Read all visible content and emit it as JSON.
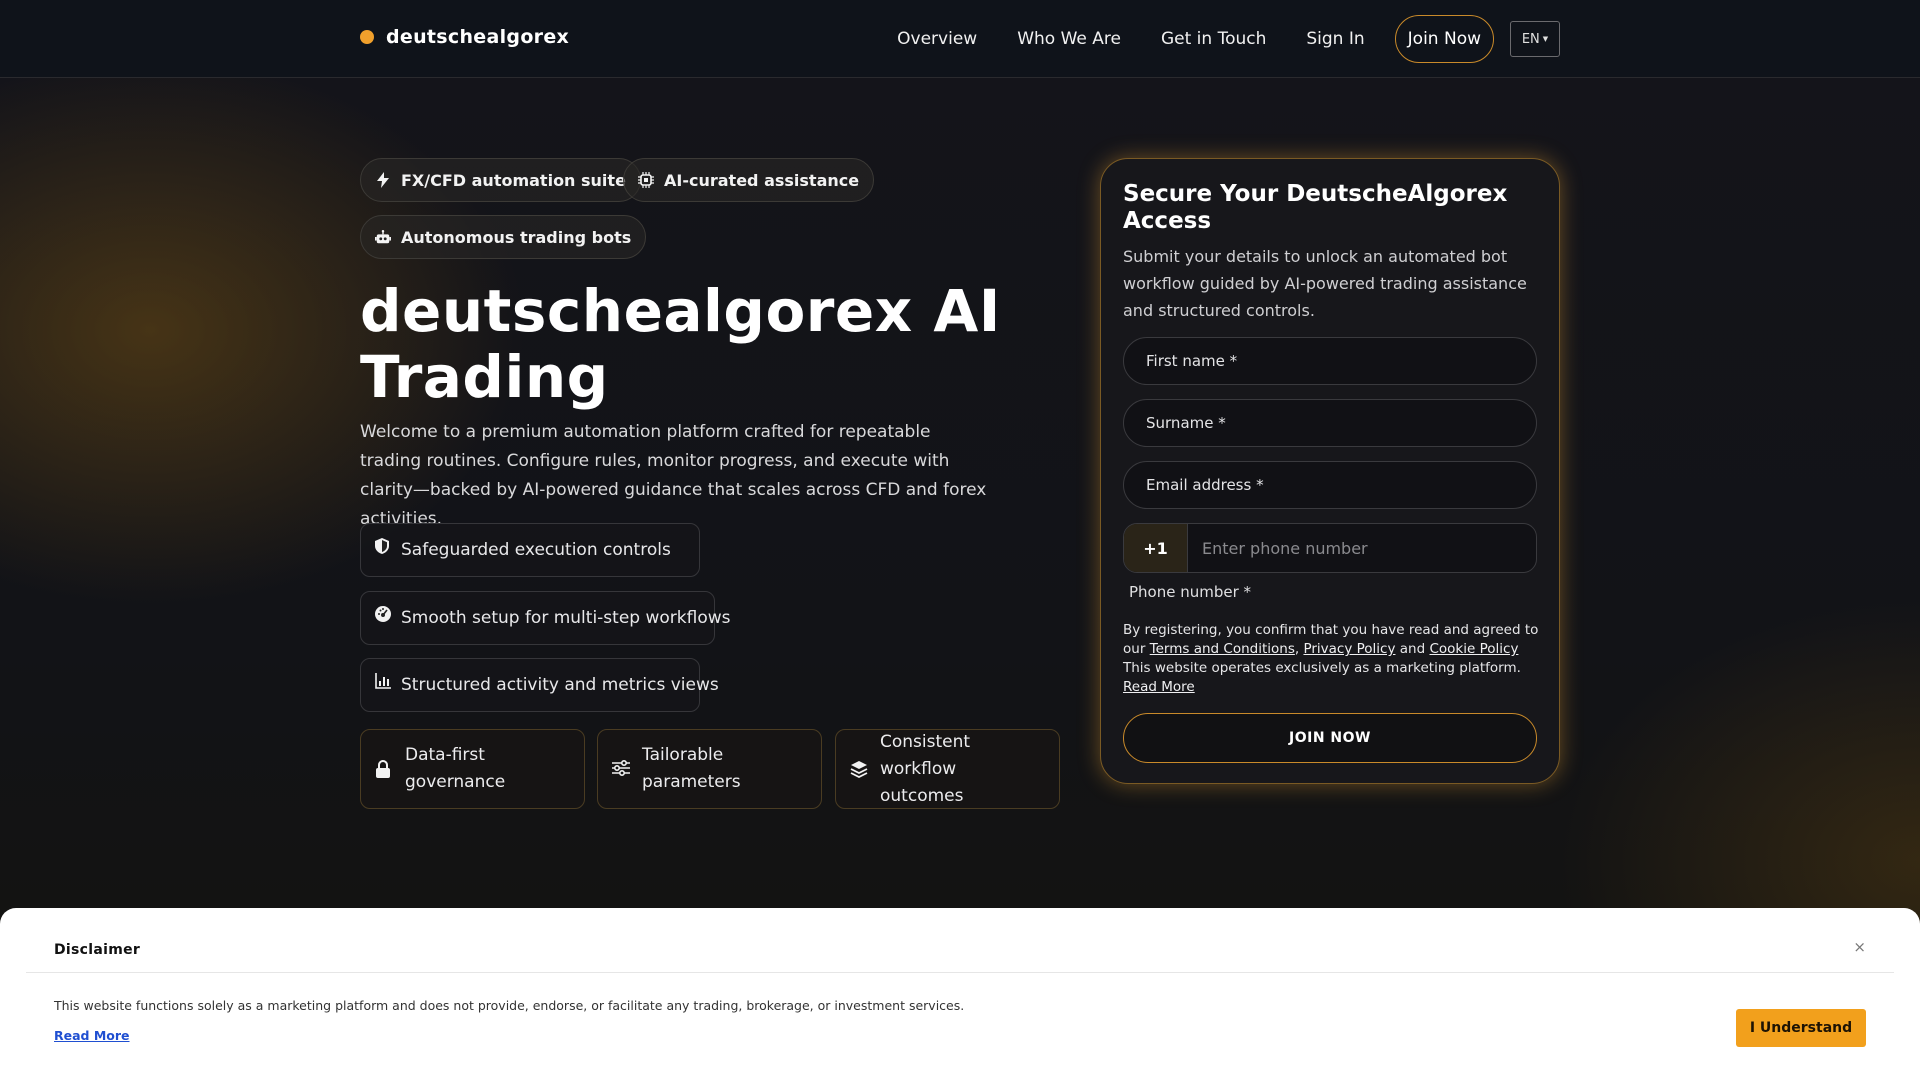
{
  "header": {
    "brand": "deutschealgorex",
    "nav": [
      "Overview",
      "Who We Are",
      "Get in Touch",
      "Sign In"
    ],
    "join_label": "Join Now",
    "language": "EN"
  },
  "hero": {
    "chips": [
      "FX/CFD automation suite",
      "AI-curated assistance",
      "Autonomous trading bots"
    ],
    "title": "deutschealgorex AI Trading",
    "description": "Welcome to a premium automation platform crafted for repeatable trading routines. Configure rules, monitor progress, and execute with clarity—backed by AI-powered guidance that scales across CFD and forex activities.",
    "features": [
      "Safeguarded execution controls",
      "Smooth setup for multi-step workflows",
      "Structured activity and metrics views"
    ],
    "cards": [
      "Data-first governance",
      "Tailorable parameters",
      "Consistent workflow outcomes"
    ]
  },
  "form": {
    "title": "Secure Your DeutscheAlgorex Access",
    "subtitle": "Submit your details to unlock an automated bot workflow guided by AI-powered trading assistance and structured controls.",
    "first_name": "First name *",
    "surname": "Surname *",
    "email": "Email address *",
    "phone_code": "+1",
    "phone_placeholder": "Enter phone number",
    "phone_label": "Phone number *",
    "consent_prefix": "By registering, you confirm that you have read and agreed to our",
    "terms": "Terms and Conditions",
    "privacy": "Privacy Policy",
    "and": "and",
    "cookie": "Cookie Policy",
    "consent_suffix": "This website operates exclusively as a marketing platform.",
    "read_more": "Read More",
    "submit": "JOIN NOW"
  },
  "disclaimer": {
    "title": "Disclaimer",
    "close": "×",
    "text": "This website functions solely as a marketing platform and does not provide, endorse, or facilitate any trading, brokerage, or investment services.",
    "read_more": "Read More",
    "button": "I Understand"
  },
  "colors": {
    "accent": "#f2a01c",
    "background": "#0e1117",
    "card_border": "#7a5a24"
  }
}
